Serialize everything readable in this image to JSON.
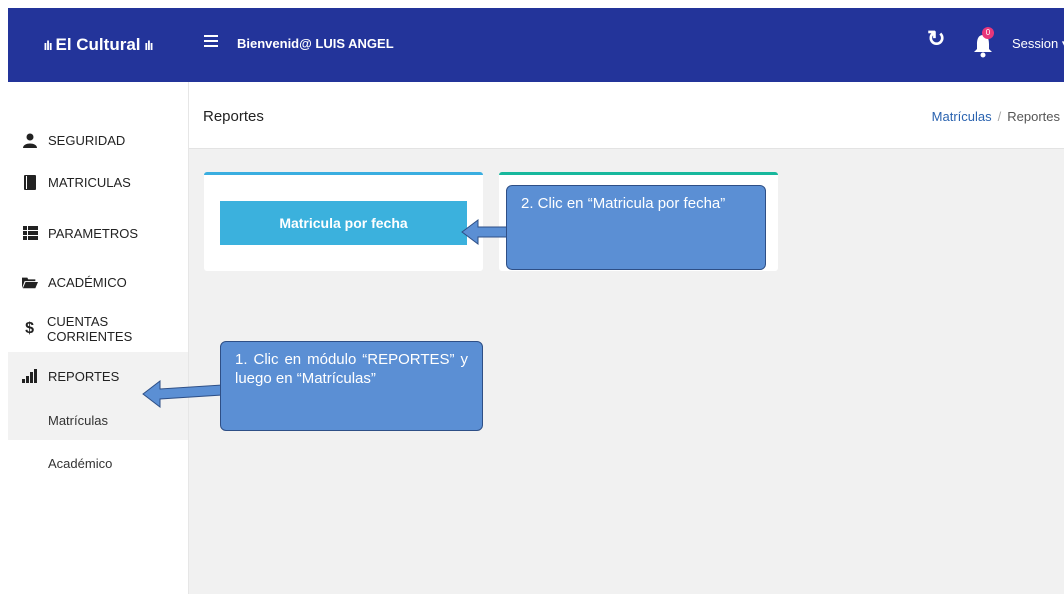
{
  "brand": {
    "name": "El Cultural",
    "left_deco": "ılı",
    "right_deco": "ılı"
  },
  "header": {
    "welcome": "Bienvenid@ LUIS ANGEL",
    "notification_count": "0",
    "session_label": "Session ▾"
  },
  "sidebar": {
    "items": [
      {
        "label": "SEGURIDAD",
        "icon": "user-icon"
      },
      {
        "label": "MATRICULAS",
        "icon": "book-icon"
      },
      {
        "label": "PARAMETROS",
        "icon": "list-icon"
      },
      {
        "label": "ACADÉMICO",
        "icon": "folder-open-icon"
      },
      {
        "label": "CUENTAS CORRIENTES",
        "icon": "dollar-icon"
      },
      {
        "label": "REPORTES",
        "icon": "bar-chart-icon"
      }
    ],
    "sub_items": [
      "Matrículas",
      "Académico"
    ]
  },
  "page": {
    "title": "Reportes",
    "breadcrumb": {
      "link": "Matrículas",
      "separator": "/",
      "current": "Reportes"
    }
  },
  "cards": {
    "button_label": "Matricula por fecha"
  },
  "annotations": {
    "step2": "2. Clic en “Matricula por fecha”",
    "step1": "1. Clic en módulo “REPORTES” y luego en “Matrículas”"
  },
  "colors": {
    "topbar": "#23349a",
    "button": "#3bb1dd",
    "card1_border": "#3aaee0",
    "card2_border": "#18b89d",
    "callout": "#5b8fd4",
    "badge": "#e8367a"
  }
}
